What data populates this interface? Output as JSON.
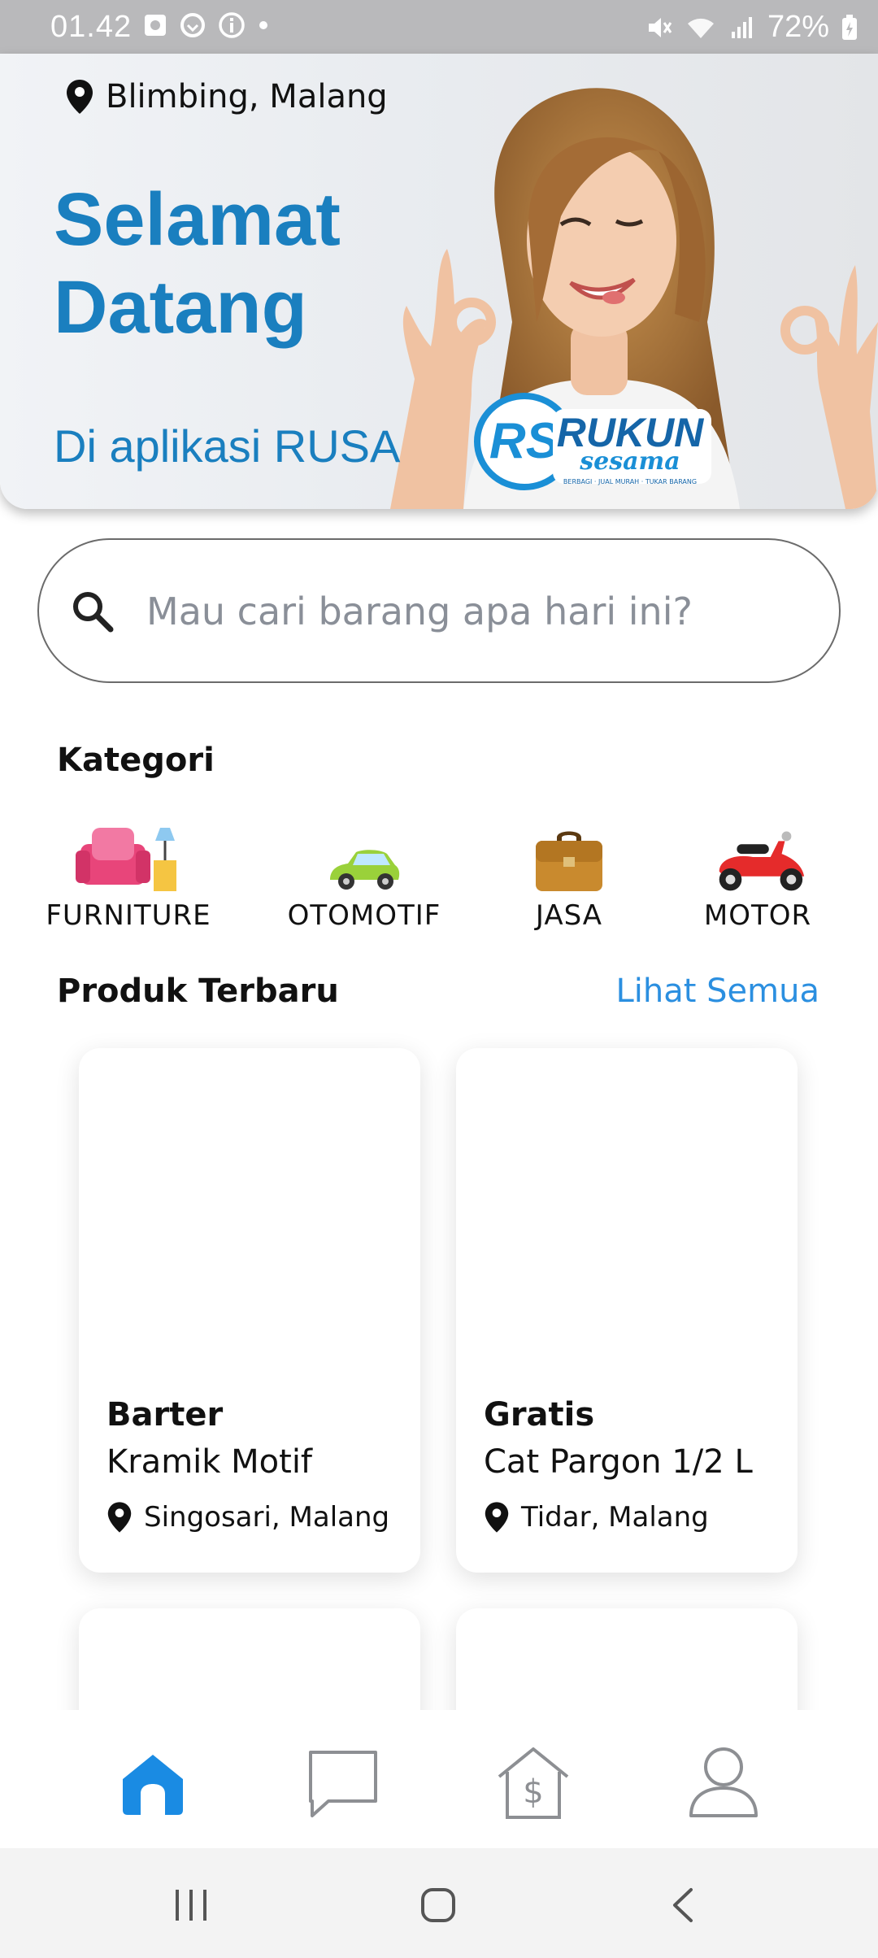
{
  "status_bar": {
    "time": "01.42",
    "battery": "72%"
  },
  "hero": {
    "location": "Blimbing, Malang",
    "title_line1": "Selamat",
    "title_line2": "Datang",
    "subtitle": "Di aplikasi RUSA",
    "logo_text": "RUKUN",
    "logo_sub": "sesama",
    "logo_tagline": "BERBAGI · JUAL MURAH · TUKAR BARANG"
  },
  "search": {
    "placeholder": "Mau cari barang apa hari ini?"
  },
  "categories": {
    "title": "Kategori",
    "items": [
      {
        "label": "FURNITURE",
        "icon": "furniture-icon"
      },
      {
        "label": "OTOMOTIF",
        "icon": "car-icon"
      },
      {
        "label": "JASA",
        "icon": "briefcase-icon"
      },
      {
        "label": "MOTOR",
        "icon": "scooter-icon"
      }
    ]
  },
  "products": {
    "title": "Produk Terbaru",
    "see_all": "Lihat Semua",
    "items": [
      {
        "type": "Barter",
        "name": "Kramik Motif",
        "location": "Singosari, Malang"
      },
      {
        "type": "Gratis",
        "name": "Cat Pargon 1/2 L",
        "location": "Tidar, Malang"
      }
    ]
  },
  "bottom_nav": {
    "items": [
      "home-icon",
      "chat-icon",
      "sell-house-icon",
      "profile-icon"
    ],
    "active": "home-icon",
    "active_color": "#1a8be3",
    "inactive_color": "#8d8f93"
  },
  "system_nav": {
    "items": [
      "recent-apps-icon",
      "home-circle-icon",
      "back-icon"
    ]
  }
}
